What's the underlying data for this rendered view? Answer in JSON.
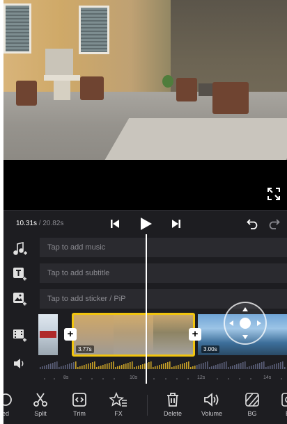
{
  "player": {
    "current_time": "10.31s",
    "separator": " / ",
    "total_time": "20.82s"
  },
  "tracks": [
    {
      "id": "music",
      "placeholder": "Tap to add music",
      "icon": "music-add-icon"
    },
    {
      "id": "subtitle",
      "placeholder": "Tap to add subtitle",
      "icon": "text-add-icon"
    },
    {
      "id": "sticker",
      "placeholder": "Tap to add sticker / PiP",
      "icon": "sticker-add-icon"
    }
  ],
  "clips": {
    "selected_duration": "3.77s",
    "next_duration": "3.00s"
  },
  "ruler": {
    "ticks": [
      "8s",
      "10s",
      "12s",
      "14s"
    ]
  },
  "toolbar": {
    "items": [
      {
        "label": "ed",
        "icon": "cut-partial-icon"
      },
      {
        "label": "Split",
        "icon": "scissors-icon"
      },
      {
        "label": "Trim",
        "icon": "trim-icon"
      },
      {
        "label": "FX",
        "icon": "fx-star-icon"
      },
      {
        "label": "Delete",
        "icon": "trash-icon"
      },
      {
        "label": "Volume",
        "icon": "volume-icon"
      },
      {
        "label": "BG",
        "icon": "background-icon"
      },
      {
        "label": "Bl",
        "icon": "blur-icon"
      }
    ]
  },
  "colors": {
    "selection": "#f1c40f",
    "panel": "#1d1d21",
    "track": "#2a2a2f"
  }
}
